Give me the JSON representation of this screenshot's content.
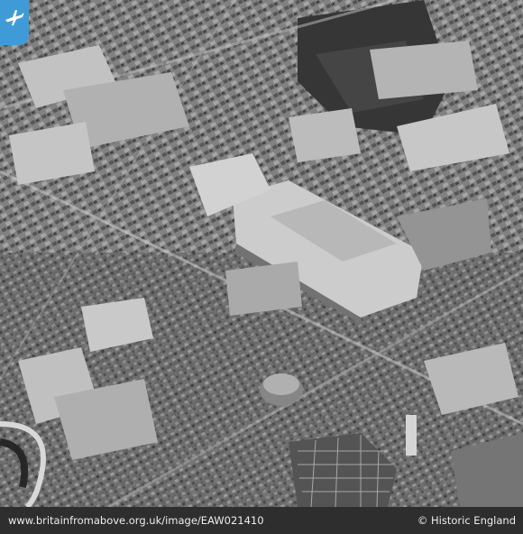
{
  "photo": {
    "image_id": "EAW021410",
    "description": "Black and white aerial photograph of dense urban city blocks",
    "tone": "monochrome"
  },
  "badge": {
    "icon": "airplane-icon",
    "color": "#3f9bd7"
  },
  "footer": {
    "url_text": "www.britainfromabove.org.uk/image/EAW021410",
    "credit_text": "© Historic England"
  }
}
